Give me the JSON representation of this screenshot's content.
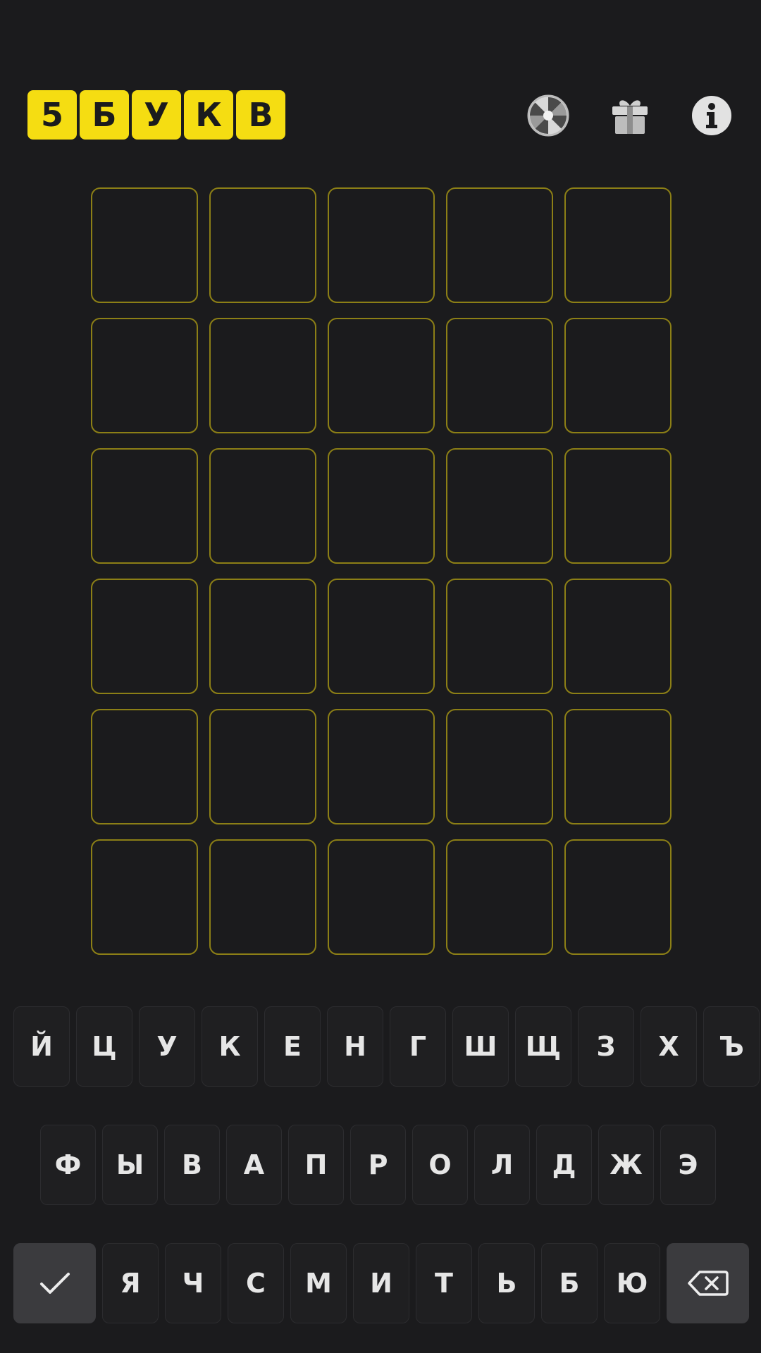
{
  "logo": {
    "letters": [
      "5",
      "Б",
      "У",
      "К",
      "В"
    ],
    "color": "#f5dd12"
  },
  "header": {
    "icons": [
      "wheel-of-fortune-icon",
      "gift-icon",
      "info-icon"
    ]
  },
  "board": {
    "rows": 6,
    "cols": 5,
    "border_color": "#8c7f16",
    "cells": [
      [
        "",
        "",
        "",
        "",
        ""
      ],
      [
        "",
        "",
        "",
        "",
        ""
      ],
      [
        "",
        "",
        "",
        "",
        ""
      ],
      [
        "",
        "",
        "",
        "",
        ""
      ],
      [
        "",
        "",
        "",
        "",
        ""
      ],
      [
        "",
        "",
        "",
        "",
        ""
      ]
    ]
  },
  "keyboard": {
    "row1": [
      "Й",
      "Ц",
      "У",
      "К",
      "Е",
      "Н",
      "Г",
      "Ш",
      "Щ",
      "З",
      "Х",
      "Ъ"
    ],
    "row2": [
      "Ф",
      "Ы",
      "В",
      "А",
      "П",
      "Р",
      "О",
      "Л",
      "Д",
      "Ж",
      "Э"
    ],
    "row3": [
      "Я",
      "Ч",
      "С",
      "М",
      "И",
      "Т",
      "Ь",
      "Б",
      "Ю"
    ],
    "enter_icon": "check-icon",
    "backspace_icon": "backspace-icon"
  }
}
